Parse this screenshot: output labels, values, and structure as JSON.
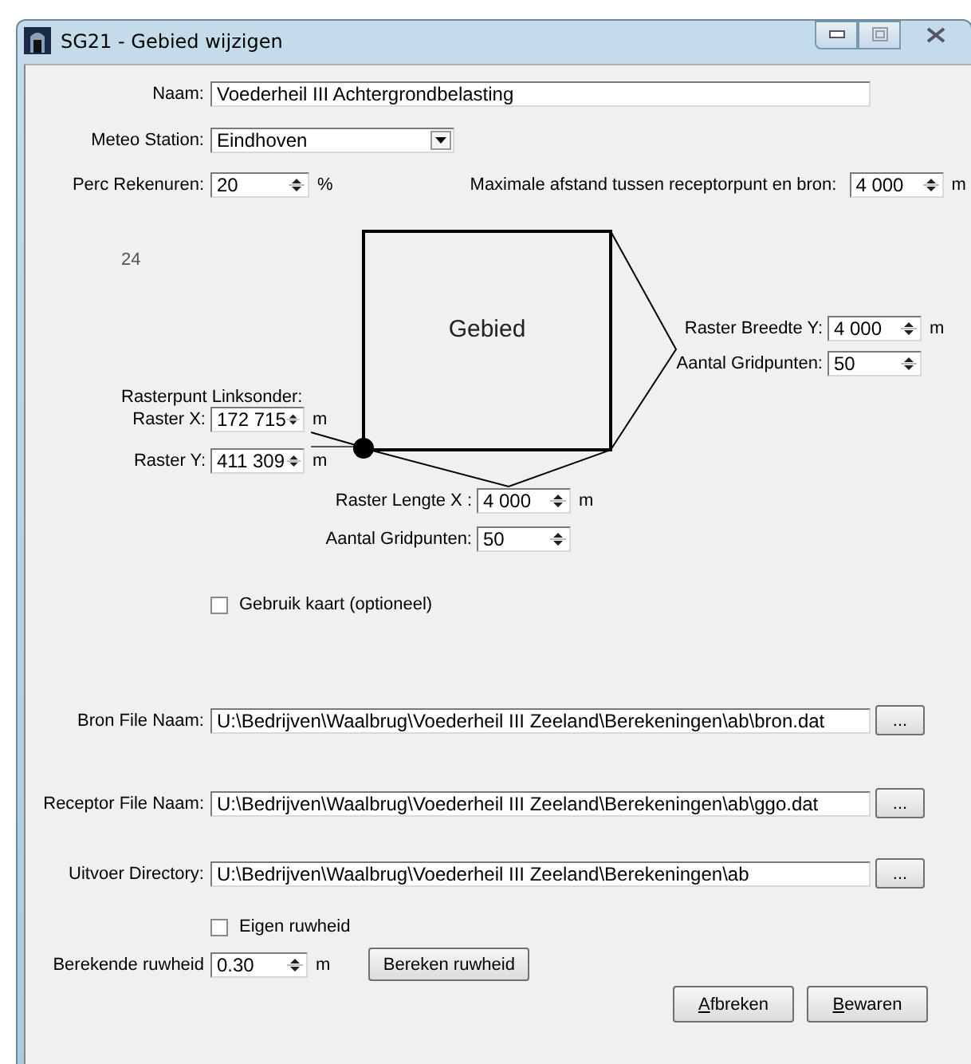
{
  "window": {
    "title": "SG21 - Gebied wijzigen"
  },
  "naam": {
    "label": "Naam:",
    "value": "Voederheil III Achtergrondbelasting"
  },
  "meteo_station": {
    "label": "Meteo Station:",
    "value": "Eindhoven"
  },
  "perc_rekenuren": {
    "label": "Perc Rekenuren:",
    "value": "20",
    "unit": "%"
  },
  "max_afstand": {
    "label": "Maximale afstand tussen receptorpunt en bron:",
    "value": "4 000",
    "unit": "m"
  },
  "diagram": {
    "counter": "24",
    "area_label": "Gebied",
    "origin_heading": "Rasterpunt Linksonder:",
    "raster_x": {
      "label": "Raster X:",
      "value": "172 715",
      "unit": "m"
    },
    "raster_y": {
      "label": "Raster Y:",
      "value": "411 309",
      "unit": "m"
    },
    "breedte_y": {
      "label": "Raster Breedte Y:",
      "value": "4 000",
      "unit": "m"
    },
    "breedte_gridpunten": {
      "label": "Aantal Gridpunten:",
      "value": "50"
    },
    "lengte_x": {
      "label": "Raster Lengte X :",
      "value": "4 000",
      "unit": "m"
    },
    "lengte_gridpunten": {
      "label": "Aantal Gridpunten:",
      "value": "50"
    }
  },
  "gebruik_kaart": {
    "label": "Gebruik kaart (optioneel)",
    "checked": false
  },
  "files": [
    {
      "label": "Bron File Naam:",
      "value": "U:\\Bedrijven\\Waalbrug\\Voederheil III Zeeland\\Berekeningen\\ab\\bron.dat",
      "button": "..."
    },
    {
      "label": "Receptor File Naam:",
      "value": "U:\\Bedrijven\\Waalbrug\\Voederheil III Zeeland\\Berekeningen\\ab\\ggo.dat",
      "button": "..."
    },
    {
      "label": "Uitvoer Directory:",
      "value": "U:\\Bedrijven\\Waalbrug\\Voederheil III Zeeland\\Berekeningen\\ab",
      "button": "..."
    }
  ],
  "eigen_ruwheid": {
    "label": "Eigen ruwheid",
    "checked": false
  },
  "berekende_ruwheid": {
    "label": "Berekende ruwheid",
    "value": "0.30",
    "unit": "m",
    "button": "Bereken ruwheid"
  },
  "buttons": [
    {
      "label": "Afbreken"
    },
    {
      "label": "Bewaren"
    }
  ]
}
